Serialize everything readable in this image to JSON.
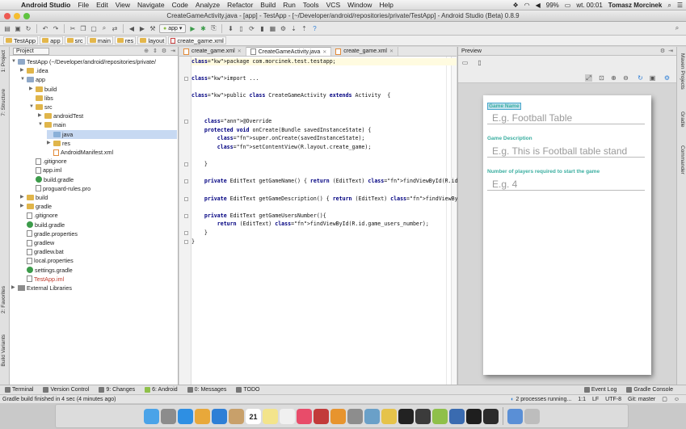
{
  "menubar": {
    "app_name": "Android Studio",
    "items": [
      "File",
      "Edit",
      "View",
      "Navigate",
      "Code",
      "Analyze",
      "Refactor",
      "Build",
      "Run",
      "Tools",
      "VCS",
      "Window",
      "Help"
    ],
    "battery": "99%",
    "clock": "wt. 00:01",
    "user": "Tomasz Morcinek"
  },
  "window": {
    "title": "CreateGameActivity.java - [app] - TestApp - [~/Developer/android/repositories/private/TestApp] - Android Studio (Beta) 0.8.9"
  },
  "toolbar": {
    "run_config": "app"
  },
  "breadcrumbs": [
    "TestApp",
    "app",
    "src",
    "main",
    "res",
    "layout",
    "create_game.xml"
  ],
  "left_stripe": {
    "project_tab": "1: Project",
    "structure_tab": "7: Structure",
    "favorites_tab": "2: Favorites",
    "build_variants_tab": "Build Variants"
  },
  "right_stripe": {
    "maven_tab": "Maven Projects",
    "gradle_tab": "Gradle",
    "commander_tab": "Commander"
  },
  "project_panel": {
    "view_mode": "Project",
    "tree": [
      {
        "label": "TestApp (~/Developer/android/repositories/private/",
        "indent": 0,
        "expanded": true,
        "icon": "module"
      },
      {
        "label": ".idea",
        "indent": 1,
        "expanded": false,
        "icon": "folder"
      },
      {
        "label": "app",
        "indent": 1,
        "expanded": true,
        "icon": "module"
      },
      {
        "label": "build",
        "indent": 2,
        "expanded": false,
        "icon": "folder"
      },
      {
        "label": "libs",
        "indent": 2,
        "expanded": null,
        "icon": "folder"
      },
      {
        "label": "src",
        "indent": 2,
        "expanded": true,
        "icon": "folder"
      },
      {
        "label": "androidTest",
        "indent": 3,
        "expanded": false,
        "icon": "folder"
      },
      {
        "label": "main",
        "indent": 3,
        "expanded": true,
        "icon": "folder"
      },
      {
        "label": "java",
        "indent": 4,
        "expanded": null,
        "icon": "folder-blue",
        "highlight": true
      },
      {
        "label": "res",
        "indent": 4,
        "expanded": false,
        "icon": "folder"
      },
      {
        "label": "AndroidManifest.xml",
        "indent": 4,
        "expanded": null,
        "icon": "xml"
      },
      {
        "label": ".gitignore",
        "indent": 2,
        "expanded": null,
        "icon": "file"
      },
      {
        "label": "app.iml",
        "indent": 2,
        "expanded": null,
        "icon": "file"
      },
      {
        "label": "build.gradle",
        "indent": 2,
        "expanded": null,
        "icon": "gradle"
      },
      {
        "label": "proguard-rules.pro",
        "indent": 2,
        "expanded": null,
        "icon": "file"
      },
      {
        "label": "build",
        "indent": 1,
        "expanded": false,
        "icon": "folder"
      },
      {
        "label": "gradle",
        "indent": 1,
        "expanded": false,
        "icon": "folder"
      },
      {
        "label": ".gitignore",
        "indent": 1,
        "expanded": null,
        "icon": "file"
      },
      {
        "label": "build.gradle",
        "indent": 1,
        "expanded": null,
        "icon": "gradle"
      },
      {
        "label": "gradle.properties",
        "indent": 1,
        "expanded": null,
        "icon": "file"
      },
      {
        "label": "gradlew",
        "indent": 1,
        "expanded": null,
        "icon": "file"
      },
      {
        "label": "gradlew.bat",
        "indent": 1,
        "expanded": null,
        "icon": "file"
      },
      {
        "label": "local.properties",
        "indent": 1,
        "expanded": null,
        "icon": "file"
      },
      {
        "label": "settings.gradle",
        "indent": 1,
        "expanded": null,
        "icon": "gradle"
      },
      {
        "label": "TestApp.iml",
        "indent": 1,
        "expanded": null,
        "icon": "file"
      },
      {
        "label": "External Libraries",
        "indent": 0,
        "expanded": false,
        "icon": "lib"
      }
    ]
  },
  "editor": {
    "tabs": [
      {
        "label": "create_game.xml",
        "active": false
      },
      {
        "label": "CreateGameActivity.java",
        "active": true
      },
      {
        "label": "create_game.xml",
        "active": false
      }
    ],
    "lines": [
      "package com.morcinek.test.testapp;",
      "",
      "import ...",
      "",
      "public class CreateGameActivity extends Activity  {",
      "",
      "",
      "    @Override",
      "    protected void onCreate(Bundle savedInstanceState) {",
      "        super.onCreate(savedInstanceState);",
      "        setContentView(R.layout.create_game);",
      "",
      "    }",
      "",
      "    private EditText getGameName() { return (EditText) findViewById(R.id.game",
      "",
      "    private EditText getGameDescription() { return (EditText) findViewById(R.",
      "",
      "    private EditText getGameUsersNumber(){",
      "        return (EditText) findViewById(R.id.game_users_number);",
      "    }",
      "}"
    ]
  },
  "preview": {
    "title": "Preview",
    "form": [
      {
        "label": "Game Name",
        "hint": "E.g. Football Table",
        "selected": true
      },
      {
        "label": "Game Description",
        "hint": "E.g. This is Football table stand",
        "selected": false
      },
      {
        "label": "Number of players required to start the game",
        "hint": "E.g. 4",
        "selected": false
      }
    ],
    "label_color": "#3aaea0"
  },
  "bottom_tabs": {
    "left": [
      {
        "label": "Terminal"
      },
      {
        "label": "Version Control"
      },
      {
        "label": "9: Changes"
      },
      {
        "label": "6: Android"
      },
      {
        "label": "0: Messages"
      },
      {
        "label": "TODO"
      }
    ],
    "right": [
      {
        "label": "Event Log"
      },
      {
        "label": "Gradle Console"
      }
    ]
  },
  "statusbar": {
    "message": "Gradle build finished in 4 sec (4 minutes ago)",
    "processes": "2 processes running...",
    "position": "1:1",
    "line_sep": "LF",
    "encoding": "UTF-8",
    "vcs": "Git: master"
  },
  "dock": {
    "apps": [
      "finder",
      "launchpad",
      "app-store",
      "photos",
      "safari",
      "contacts",
      "calendar",
      "notes",
      "reminders",
      "itunes",
      "photo-booth",
      "ibooks",
      "system-preferences",
      "preview",
      "chrome",
      "terminal",
      "activity-monitor",
      "android-studio",
      "sourcetree",
      "quicktime",
      "dashboard",
      "downloads",
      "trash"
    ],
    "calendar_day": "21"
  },
  "colors": {
    "dock_colors": [
      "#4aa3e8",
      "#8c8c8c",
      "#2e8fe3",
      "#e8a83a",
      "#2e7fd6",
      "#c8a06a",
      "#ffffff",
      "#f3e48b",
      "#f0f0f0",
      "#e84c6a",
      "#c23a3a",
      "#e7942e",
      "#8d8d8d",
      "#6aa0c8",
      "#e6c34a",
      "#222222",
      "#3b3b3b",
      "#8fc04a",
      "#3a6bb0",
      "#1e1e1e",
      "#2b2b2b",
      "#5a8fd6",
      "#bdbdbd"
    ]
  }
}
